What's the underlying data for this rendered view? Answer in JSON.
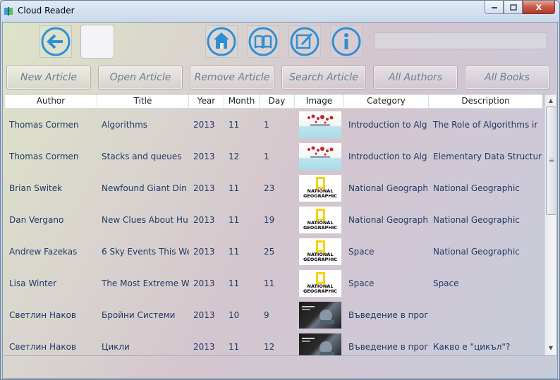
{
  "window": {
    "title": "Cloud Reader",
    "controls": {
      "minimize": "—",
      "maximize": "□",
      "close": "x"
    }
  },
  "toolbar": {
    "icons": [
      "back-icon",
      "home-icon",
      "book-icon",
      "edit-icon",
      "info-icon"
    ],
    "search_value": ""
  },
  "actions": {
    "new_article": "New Article",
    "open_article": "Open Article",
    "remove_article": "Remove Article",
    "search_article": "Search Article",
    "all_authors": "All Authors",
    "all_books": "All Books"
  },
  "grid": {
    "columns": [
      "Author",
      "Title",
      "Year",
      "Month",
      "Day",
      "Image",
      "Category",
      "Description"
    ],
    "rows": [
      {
        "author": "Thomas Cormen",
        "title": "Algorithms",
        "year": "2013",
        "month": "11",
        "day": "1",
        "image": "algorithms-cover",
        "category": "Introduction to Alg",
        "description": "The Role of Algorithms ir"
      },
      {
        "author": "Thomas Cormen",
        "title": "Stacks and queues",
        "year": "2013",
        "month": "12",
        "day": "1",
        "image": "algorithms-cover",
        "category": "Introduction to Alg",
        "description": "Elementary Data Structur"
      },
      {
        "author": "Brian Switek",
        "title": "Newfound Giant Din",
        "year": "2013",
        "month": "11",
        "day": "23",
        "image": "national-geographic-logo",
        "category": "National Geograph",
        "description": "National Geographic"
      },
      {
        "author": "Dan Vergano",
        "title": "New Clues About Hu",
        "year": "2013",
        "month": "11",
        "day": "19",
        "image": "national-geographic-logo",
        "category": "National Geograph",
        "description": "National Geographic"
      },
      {
        "author": "Andrew Fazekas",
        "title": "6 Sky Events This We",
        "year": "2013",
        "month": "11",
        "day": "25",
        "image": "national-geographic-logo",
        "category": "Space",
        "description": "National Geographic"
      },
      {
        "author": "Lisa Winter",
        "title": "The Most Extreme W",
        "year": "2013",
        "month": "11",
        "day": "11",
        "image": "national-geographic-logo",
        "category": "Space",
        "description": "Space"
      },
      {
        "author": "Светлин Наков",
        "title": "Бройни Системи",
        "year": "2013",
        "month": "10",
        "day": "9",
        "image": "programming-book-cover",
        "category": "Въведение в прогр",
        "description": ""
      },
      {
        "author": "Светлин Наков",
        "title": "Цикли",
        "year": "2013",
        "month": "11",
        "day": "12",
        "image": "programming-book-cover",
        "category": "Въведение в прогр",
        "description": "Какво е \"цикъл\"?"
      }
    ],
    "ng_logo_text": [
      "NATIONAL",
      "GEOGRAPHIC"
    ]
  },
  "colors": {
    "accent_blue": "#2f8fd6",
    "cell_text": "#1f3a66",
    "button_text": "#6c7e91"
  }
}
